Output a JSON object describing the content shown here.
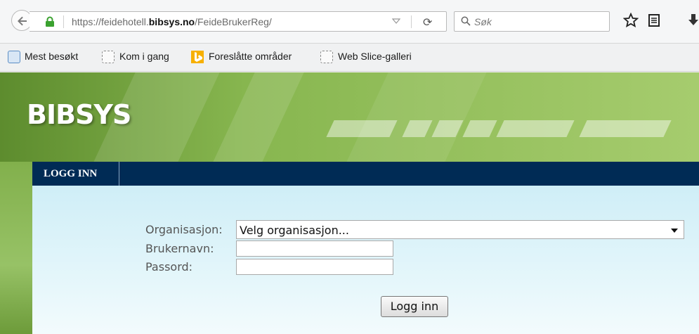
{
  "browser": {
    "url_prefix": "https://feidehotell.",
    "url_domain": "bibsys.no",
    "url_path": "/FeideBrukerReg/",
    "search_placeholder": "Søk"
  },
  "bookmarks": [
    {
      "label": "Mest besøkt",
      "icon": "ie-icon"
    },
    {
      "label": "Kom i gang",
      "icon": "blank-page-icon"
    },
    {
      "label": "Foreslåtte områder",
      "icon": "bing-icon"
    },
    {
      "label": "Web Slice-galleri",
      "icon": "blank-page-icon"
    }
  ],
  "site": {
    "logo": "BIBSYS",
    "nav_tab": "LOGG INN"
  },
  "form": {
    "org_label": "Organisasjon:",
    "org_selected": "Velg organisasjon...",
    "username_label": "Brukernavn:",
    "password_label": "Passord:",
    "username_value": "",
    "password_value": "",
    "submit_label": "Logg inn"
  },
  "colors": {
    "nav_bg": "#002b55",
    "header_green": "#87b64f",
    "content_bg": "#cfeef7"
  }
}
